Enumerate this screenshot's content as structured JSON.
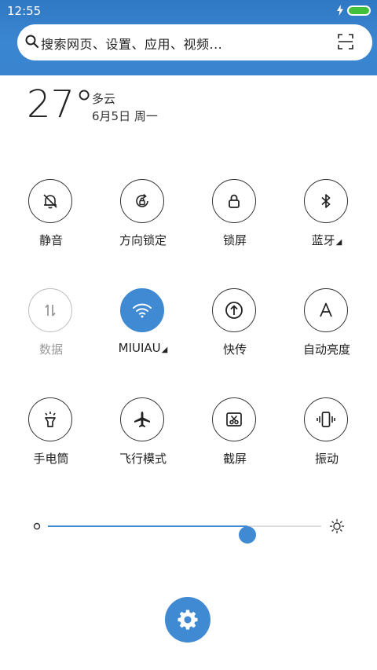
{
  "status": {
    "time": "12:55"
  },
  "search": {
    "placeholder": "搜索网页、设置、应用、视频..."
  },
  "weather": {
    "temperature": "27°",
    "condition": "多云",
    "date": "6月5日 周一"
  },
  "tiles": [
    {
      "label": "静音",
      "icon": "bell-off-icon"
    },
    {
      "label": "方向锁定",
      "icon": "rotation-lock-icon"
    },
    {
      "label": "锁屏",
      "icon": "lock-icon"
    },
    {
      "label": "蓝牙",
      "icon": "bluetooth-icon",
      "has_menu": true
    },
    {
      "label": "数据",
      "icon": "mobile-data-icon",
      "state": "disabled"
    },
    {
      "label": "MIUIAU",
      "icon": "wifi-icon",
      "state": "on",
      "has_menu": true
    },
    {
      "label": "快传",
      "icon": "quick-transfer-icon"
    },
    {
      "label": "自动亮度",
      "icon": "auto-brightness-icon"
    },
    {
      "label": "手电筒",
      "icon": "flashlight-icon"
    },
    {
      "label": "飞行模式",
      "icon": "airplane-icon"
    },
    {
      "label": "截屏",
      "icon": "screenshot-icon"
    },
    {
      "label": "振动",
      "icon": "vibrate-icon"
    }
  ],
  "brightness": {
    "level_fraction": 0.73
  },
  "colors": {
    "accent": "#3f8ad3",
    "header": "#3b86d0",
    "battery": "#42c13a"
  }
}
